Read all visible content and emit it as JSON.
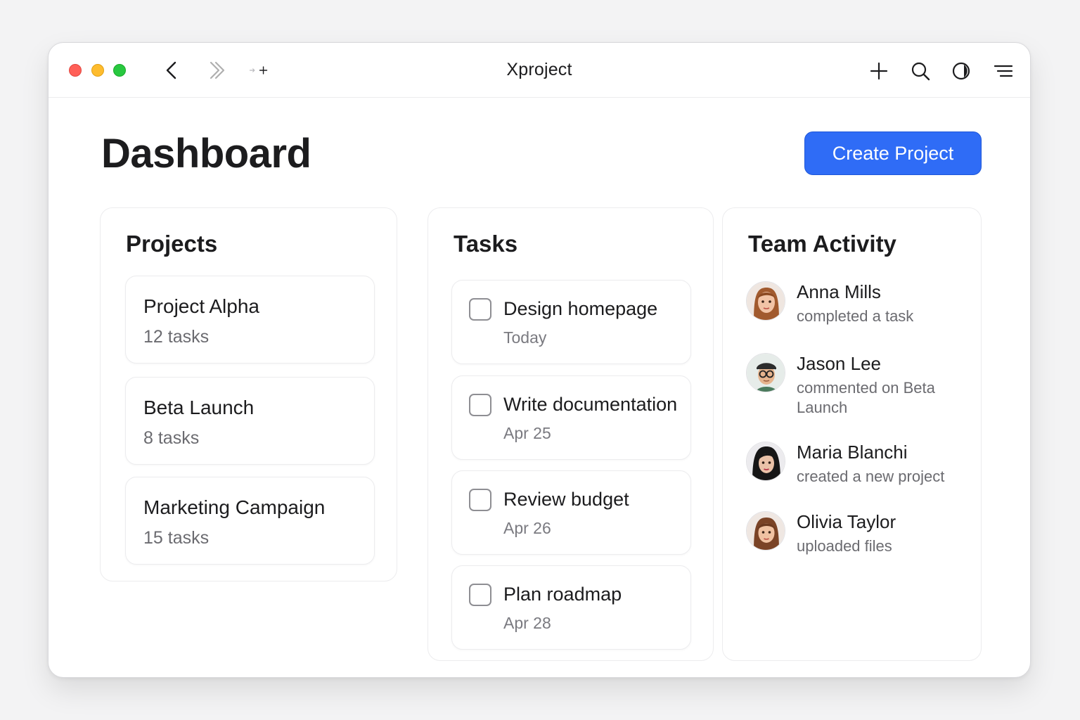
{
  "window": {
    "title": "Xproject"
  },
  "toolbar": {
    "icons": [
      "back-icon",
      "forward-icon",
      "more-icon",
      "plus-icon",
      "search-icon",
      "theme-icon",
      "menu-icon"
    ]
  },
  "header": {
    "page_title": "Dashboard",
    "create_button": "Create Project",
    "accent_color": "#2f6cf6"
  },
  "projects": {
    "title": "Projects",
    "items": [
      {
        "name": "Project Alpha",
        "count": "12 tasks"
      },
      {
        "name": "Beta Launch",
        "count": "8 tasks"
      },
      {
        "name": "Marketing Campaign",
        "count": "15 tasks"
      }
    ]
  },
  "tasks": {
    "title": "Tasks",
    "items": [
      {
        "name": "Design homepage",
        "date": "Today",
        "checked": false
      },
      {
        "name": "Write documentation",
        "date": "Apr 25",
        "checked": false
      },
      {
        "name": "Review budget",
        "date": "Apr 26",
        "checked": false
      },
      {
        "name": "Plan roadmap",
        "date": "Apr 28",
        "checked": false
      }
    ]
  },
  "activity": {
    "title": "Team Activity",
    "items": [
      {
        "name": "Anna Mills",
        "action": "completed a task"
      },
      {
        "name": "Jason Lee",
        "action": "commented on Beta Launch"
      },
      {
        "name": "Maria Blanchi",
        "action": "created a new project"
      },
      {
        "name": "Olivia Taylor",
        "action": "uploaded files"
      }
    ]
  }
}
